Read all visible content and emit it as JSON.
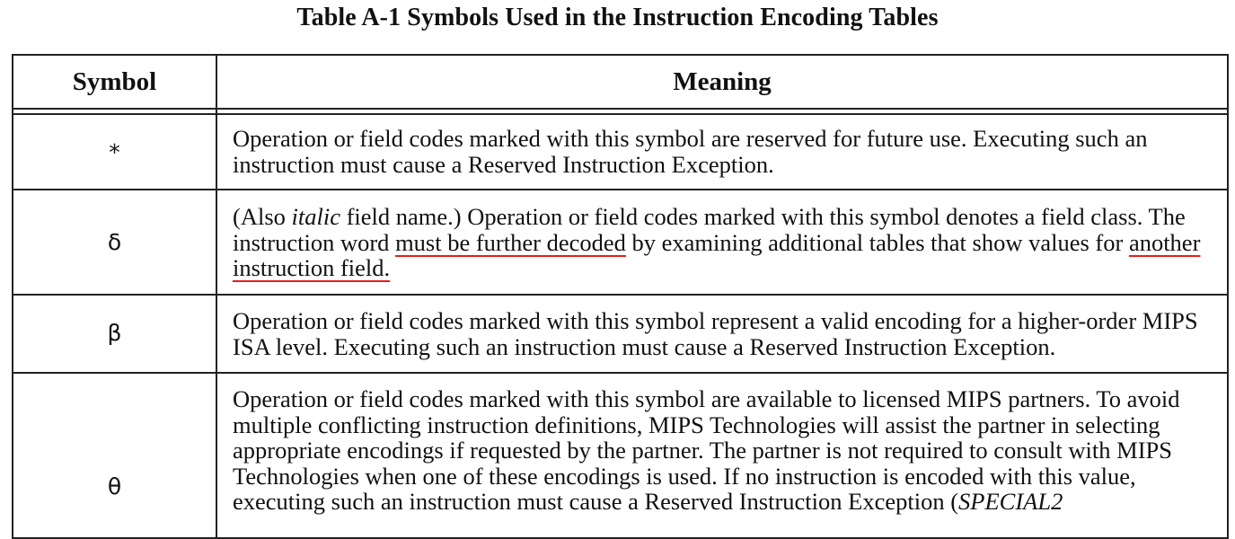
{
  "title": "Table A-1 Symbols Used in the Instruction Encoding Tables",
  "header": {
    "symbol": "Symbol",
    "meaning": "Meaning"
  },
  "rows": [
    {
      "symbol": "*",
      "meaning": "Operation or field codes marked with this symbol are reserved for future use. Executing such an instruction must cause a Reserved Instruction Exception."
    },
    {
      "symbol": "δ",
      "meaning_parts": {
        "p1": "(Also ",
        "p2_italic": "italic",
        "p3": " field name.) Operation or field codes marked with this symbol denotes a field class. The instruction word ",
        "p4_underlined": "must be further decoded",
        "p5": " by examining additional tables that show values for ",
        "p6_underlined": "another instruction field.",
        "underline_color": "#e0201c"
      }
    },
    {
      "symbol": "β",
      "meaning": "Operation or field codes marked with this symbol represent a valid encoding for a higher-order MIPS ISA level. Executing such an instruction must cause a Reserved Instruction Exception."
    },
    {
      "symbol": "θ",
      "meaning_parts": {
        "p1": "Operation or field codes marked with this symbol are available to licensed MIPS partners. To avoid multiple conflicting instruction definitions, MIPS Technologies will assist the partner in selecting appropriate encodings if requested by the partner. The partner is not required to consult with MIPS Technologies when one of these encodings is used. If no instruction is encoded with this value, executing such an instruction must cause a Reserved Instruction Exception (",
        "p2_italic": "SPECIAL2"
      }
    }
  ]
}
